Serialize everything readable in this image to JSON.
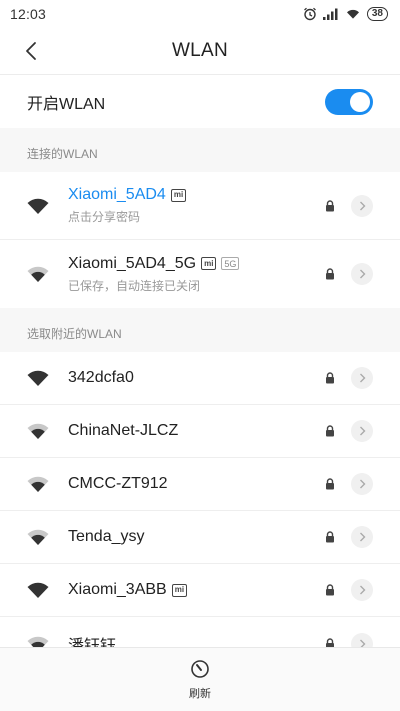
{
  "status_bar": {
    "time": "12:03",
    "battery": "38"
  },
  "header": {
    "title": "WLAN"
  },
  "toggle": {
    "label": "开启WLAN",
    "on": true
  },
  "colors": {
    "accent": "#1a8cf0"
  },
  "sections": {
    "connected_label": "连接的WLAN",
    "nearby_label": "选取附近的WLAN"
  },
  "connected": [
    {
      "name": "Xiaomi_5AD4",
      "badge": "mi",
      "sub": "点击分享密码",
      "active": true,
      "signal": "strong"
    },
    {
      "name": "Xiaomi_5AD4_5G",
      "badge": "mi",
      "tag": "5G",
      "sub": "已保存，自动连接已关闭",
      "active": false,
      "signal": "weak"
    }
  ],
  "nearby": [
    {
      "name": "342dcfa0",
      "signal": "strong"
    },
    {
      "name": "ChinaNet-JLCZ",
      "signal": "weak"
    },
    {
      "name": "CMCC-ZT912",
      "signal": "weak"
    },
    {
      "name": "Tenda_ysy",
      "signal": "weak"
    },
    {
      "name": "Xiaomi_3ABB",
      "badge": "mi",
      "signal": "strong"
    },
    {
      "name": "潘钰钰",
      "signal": "weak"
    }
  ],
  "bottom": {
    "refresh_label": "刷新"
  }
}
